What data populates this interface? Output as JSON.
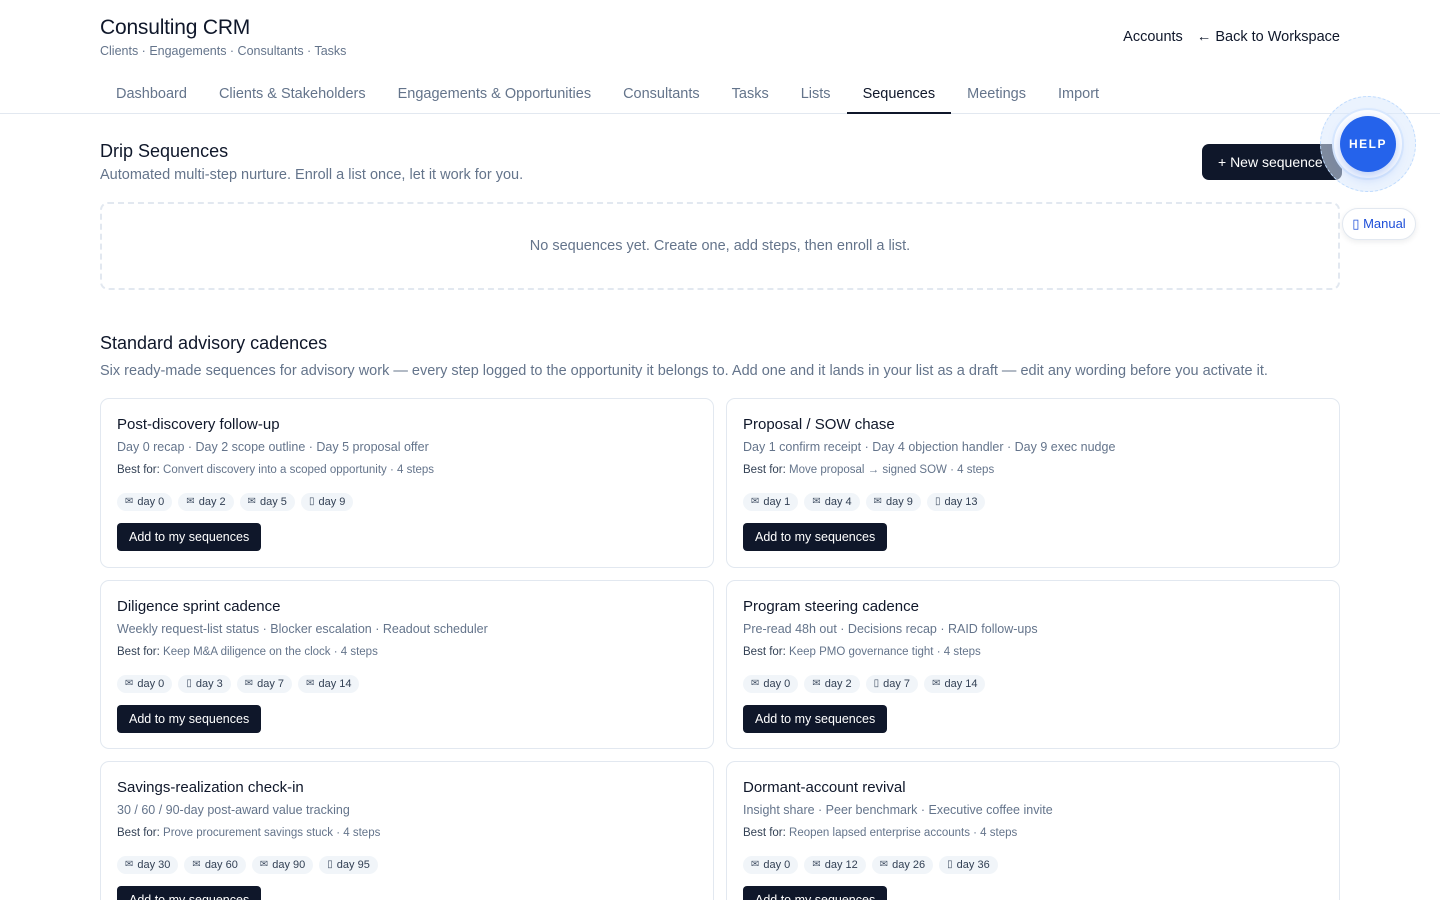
{
  "app": {
    "title": "Consulting CRM",
    "subtitle": "Clients · Engagements · Consultants · Tasks",
    "accounts_link": "Accounts",
    "back_link": "← Back to Workspace"
  },
  "nav": {
    "tabs": [
      {
        "label": "Dashboard",
        "active": false
      },
      {
        "label": "Clients & Stakeholders",
        "active": false
      },
      {
        "label": "Engagements & Opportunities",
        "active": false
      },
      {
        "label": "Consultants",
        "active": false
      },
      {
        "label": "Tasks",
        "active": false
      },
      {
        "label": "Lists",
        "active": false
      },
      {
        "label": "Sequences",
        "active": true
      },
      {
        "label": "Meetings",
        "active": false
      },
      {
        "label": "Import",
        "active": false
      }
    ]
  },
  "drip": {
    "title": "Drip Sequences",
    "subtitle": "Automated multi-step nurture. Enroll a list once, let it work for you.",
    "new_button": "+ New sequence",
    "empty_text": "No sequences yet. Create one, add steps, then enroll a list."
  },
  "help": {
    "help_label": "HELP",
    "manual_label": "▯ Manual"
  },
  "templates": {
    "title": "Standard advisory cadences",
    "subtitle": "Six ready-made sequences for advisory work — every step logged to the opportunity it belongs to. Add one and it lands in your list as a draft — edit any wording before you activate it.",
    "best_for_label": "Best for:",
    "add_label": "Add to my sequences",
    "cards": [
      {
        "title": "Post-discovery follow-up",
        "steps": "Day 0 recap · Day 2 scope outline · Day 5 proposal offer",
        "best_for": "Convert discovery into a scoped opportunity · 4 steps",
        "chips": [
          {
            "icon": "✉",
            "label": "day 0"
          },
          {
            "icon": "✉",
            "label": "day 2"
          },
          {
            "icon": "✉",
            "label": "day 5"
          },
          {
            "icon": "▯",
            "label": "day 9"
          }
        ]
      },
      {
        "title": "Proposal / SOW chase",
        "steps": "Day 1 confirm receipt · Day 4 objection handler · Day 9 exec nudge",
        "best_for": "Move proposal → signed SOW · 4 steps",
        "chips": [
          {
            "icon": "✉",
            "label": "day 1"
          },
          {
            "icon": "✉",
            "label": "day 4"
          },
          {
            "icon": "✉",
            "label": "day 9"
          },
          {
            "icon": "▯",
            "label": "day 13"
          }
        ]
      },
      {
        "title": "Diligence sprint cadence",
        "steps": "Weekly request-list status · Blocker escalation · Readout scheduler",
        "best_for": "Keep M&A diligence on the clock · 4 steps",
        "chips": [
          {
            "icon": "✉",
            "label": "day 0"
          },
          {
            "icon": "▯",
            "label": "day 3"
          },
          {
            "icon": "✉",
            "label": "day 7"
          },
          {
            "icon": "✉",
            "label": "day 14"
          }
        ]
      },
      {
        "title": "Program steering cadence",
        "steps": "Pre-read 48h out · Decisions recap · RAID follow-ups",
        "best_for": "Keep PMO governance tight · 4 steps",
        "chips": [
          {
            "icon": "✉",
            "label": "day 0"
          },
          {
            "icon": "✉",
            "label": "day 2"
          },
          {
            "icon": "▯",
            "label": "day 7"
          },
          {
            "icon": "✉",
            "label": "day 14"
          }
        ]
      },
      {
        "title": "Savings-realization check-in",
        "steps": "30 / 60 / 90-day post-award value tracking",
        "best_for": "Prove procurement savings stuck · 4 steps",
        "chips": [
          {
            "icon": "✉",
            "label": "day 30"
          },
          {
            "icon": "✉",
            "label": "day 60"
          },
          {
            "icon": "✉",
            "label": "day 90"
          },
          {
            "icon": "▯",
            "label": "day 95"
          }
        ]
      },
      {
        "title": "Dormant-account revival",
        "steps": "Insight share · Peer benchmark · Executive coffee invite",
        "best_for": "Reopen lapsed enterprise accounts · 4 steps",
        "chips": [
          {
            "icon": "✉",
            "label": "day 0"
          },
          {
            "icon": "✉",
            "label": "day 12"
          },
          {
            "icon": "✉",
            "label": "day 26"
          },
          {
            "icon": "▯",
            "label": "day 36"
          }
        ]
      }
    ]
  }
}
